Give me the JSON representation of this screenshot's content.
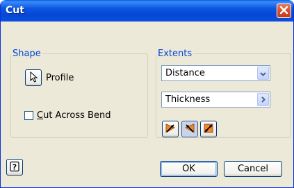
{
  "dialog": {
    "title": "Cut"
  },
  "shape": {
    "legend": "Shape",
    "profile_label": "Profile",
    "cut_across_bend_accel": "C",
    "cut_across_bend_rest": "ut Across Bend",
    "cut_across_bend_checked": false
  },
  "extents": {
    "legend": "Extents",
    "extent_type": "Distance",
    "depth": "Thickness",
    "direction_buttons": [
      "direction-1",
      "direction-2",
      "symmetric"
    ],
    "active_direction": "direction-2"
  },
  "buttons": {
    "ok": "OK",
    "cancel": "Cancel"
  },
  "colors": {
    "title_bar": "#0b56e0",
    "dialog_bg": "#ece9d8",
    "group_label": "#0046d5",
    "close_button": "#d3502c"
  }
}
